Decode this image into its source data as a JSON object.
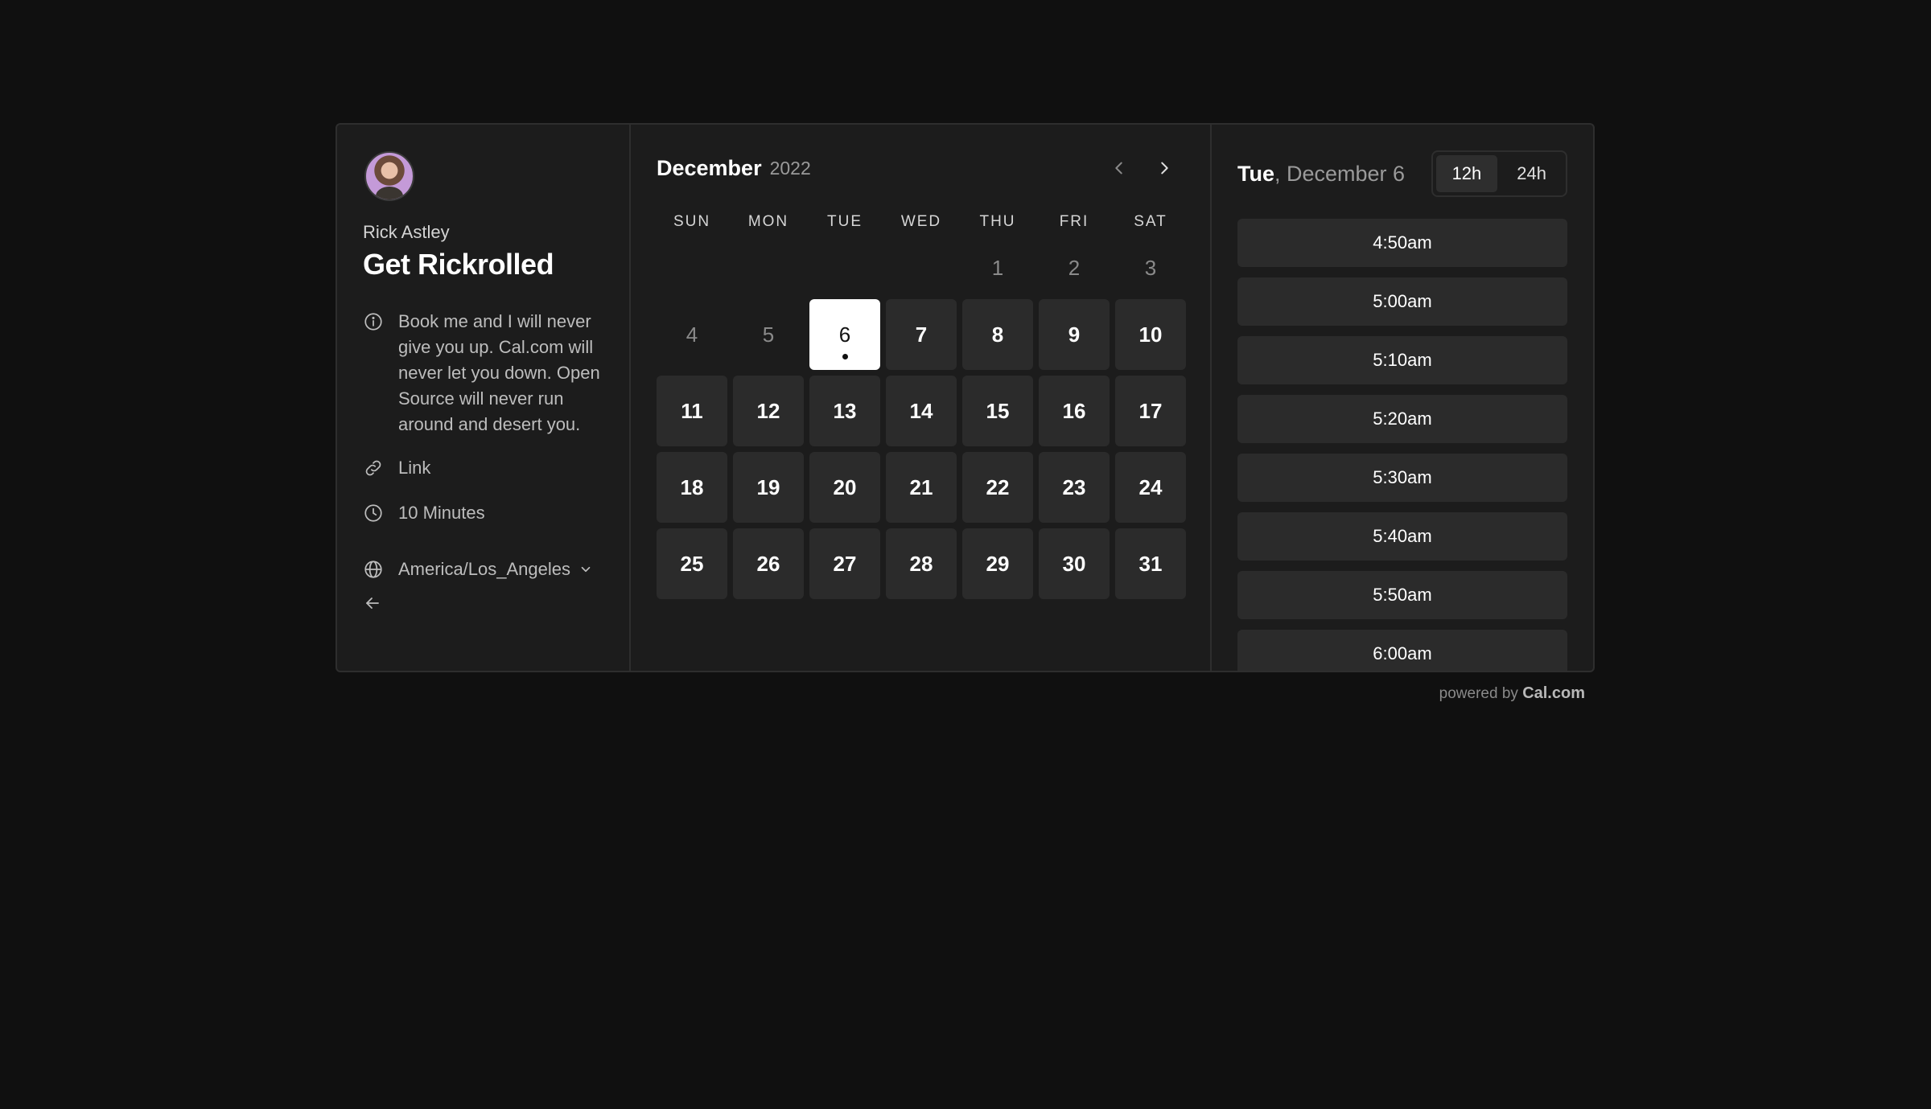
{
  "organizer": {
    "name": "Rick Astley"
  },
  "event": {
    "title": "Get Rickrolled",
    "description": "Book me and I will never give you up. Cal.com will never let you down. Open Source will never run around and desert you.",
    "location": "Link",
    "duration": "10 Minutes",
    "timezone": "America/Los_Angeles"
  },
  "calendar": {
    "month": "December",
    "year": "2022",
    "weekdays": [
      "SUN",
      "MON",
      "TUE",
      "WED",
      "THU",
      "FRI",
      "SAT"
    ],
    "leading_blanks": 4,
    "days": [
      {
        "label": "1",
        "state": "unavailable"
      },
      {
        "label": "2",
        "state": "unavailable"
      },
      {
        "label": "3",
        "state": "unavailable"
      },
      {
        "label": "4",
        "state": "unavailable"
      },
      {
        "label": "5",
        "state": "unavailable"
      },
      {
        "label": "6",
        "state": "selected"
      },
      {
        "label": "7",
        "state": "available"
      },
      {
        "label": "8",
        "state": "available"
      },
      {
        "label": "9",
        "state": "available"
      },
      {
        "label": "10",
        "state": "available"
      },
      {
        "label": "11",
        "state": "available"
      },
      {
        "label": "12",
        "state": "available"
      },
      {
        "label": "13",
        "state": "available"
      },
      {
        "label": "14",
        "state": "available"
      },
      {
        "label": "15",
        "state": "available"
      },
      {
        "label": "16",
        "state": "available"
      },
      {
        "label": "17",
        "state": "available"
      },
      {
        "label": "18",
        "state": "available"
      },
      {
        "label": "19",
        "state": "available"
      },
      {
        "label": "20",
        "state": "available"
      },
      {
        "label": "21",
        "state": "available"
      },
      {
        "label": "22",
        "state": "available"
      },
      {
        "label": "23",
        "state": "available"
      },
      {
        "label": "24",
        "state": "available"
      },
      {
        "label": "25",
        "state": "available"
      },
      {
        "label": "26",
        "state": "available"
      },
      {
        "label": "27",
        "state": "available"
      },
      {
        "label": "28",
        "state": "available"
      },
      {
        "label": "29",
        "state": "available"
      },
      {
        "label": "30",
        "state": "available"
      },
      {
        "label": "31",
        "state": "available"
      }
    ]
  },
  "slots": {
    "day_of_week": "Tue",
    "date_rest": ", December 6",
    "format_options": [
      "12h",
      "24h"
    ],
    "selected_format": "12h",
    "times": [
      "4:50am",
      "5:00am",
      "5:10am",
      "5:20am",
      "5:30am",
      "5:40am",
      "5:50am",
      "6:00am"
    ]
  },
  "footer": {
    "powered_by": "powered by",
    "brand": "Cal.com"
  },
  "colors": {
    "page_background": "#101010",
    "card_background": "#1c1c1c",
    "available_day": "#2b2b2b",
    "selected_day": "#ffffff"
  }
}
